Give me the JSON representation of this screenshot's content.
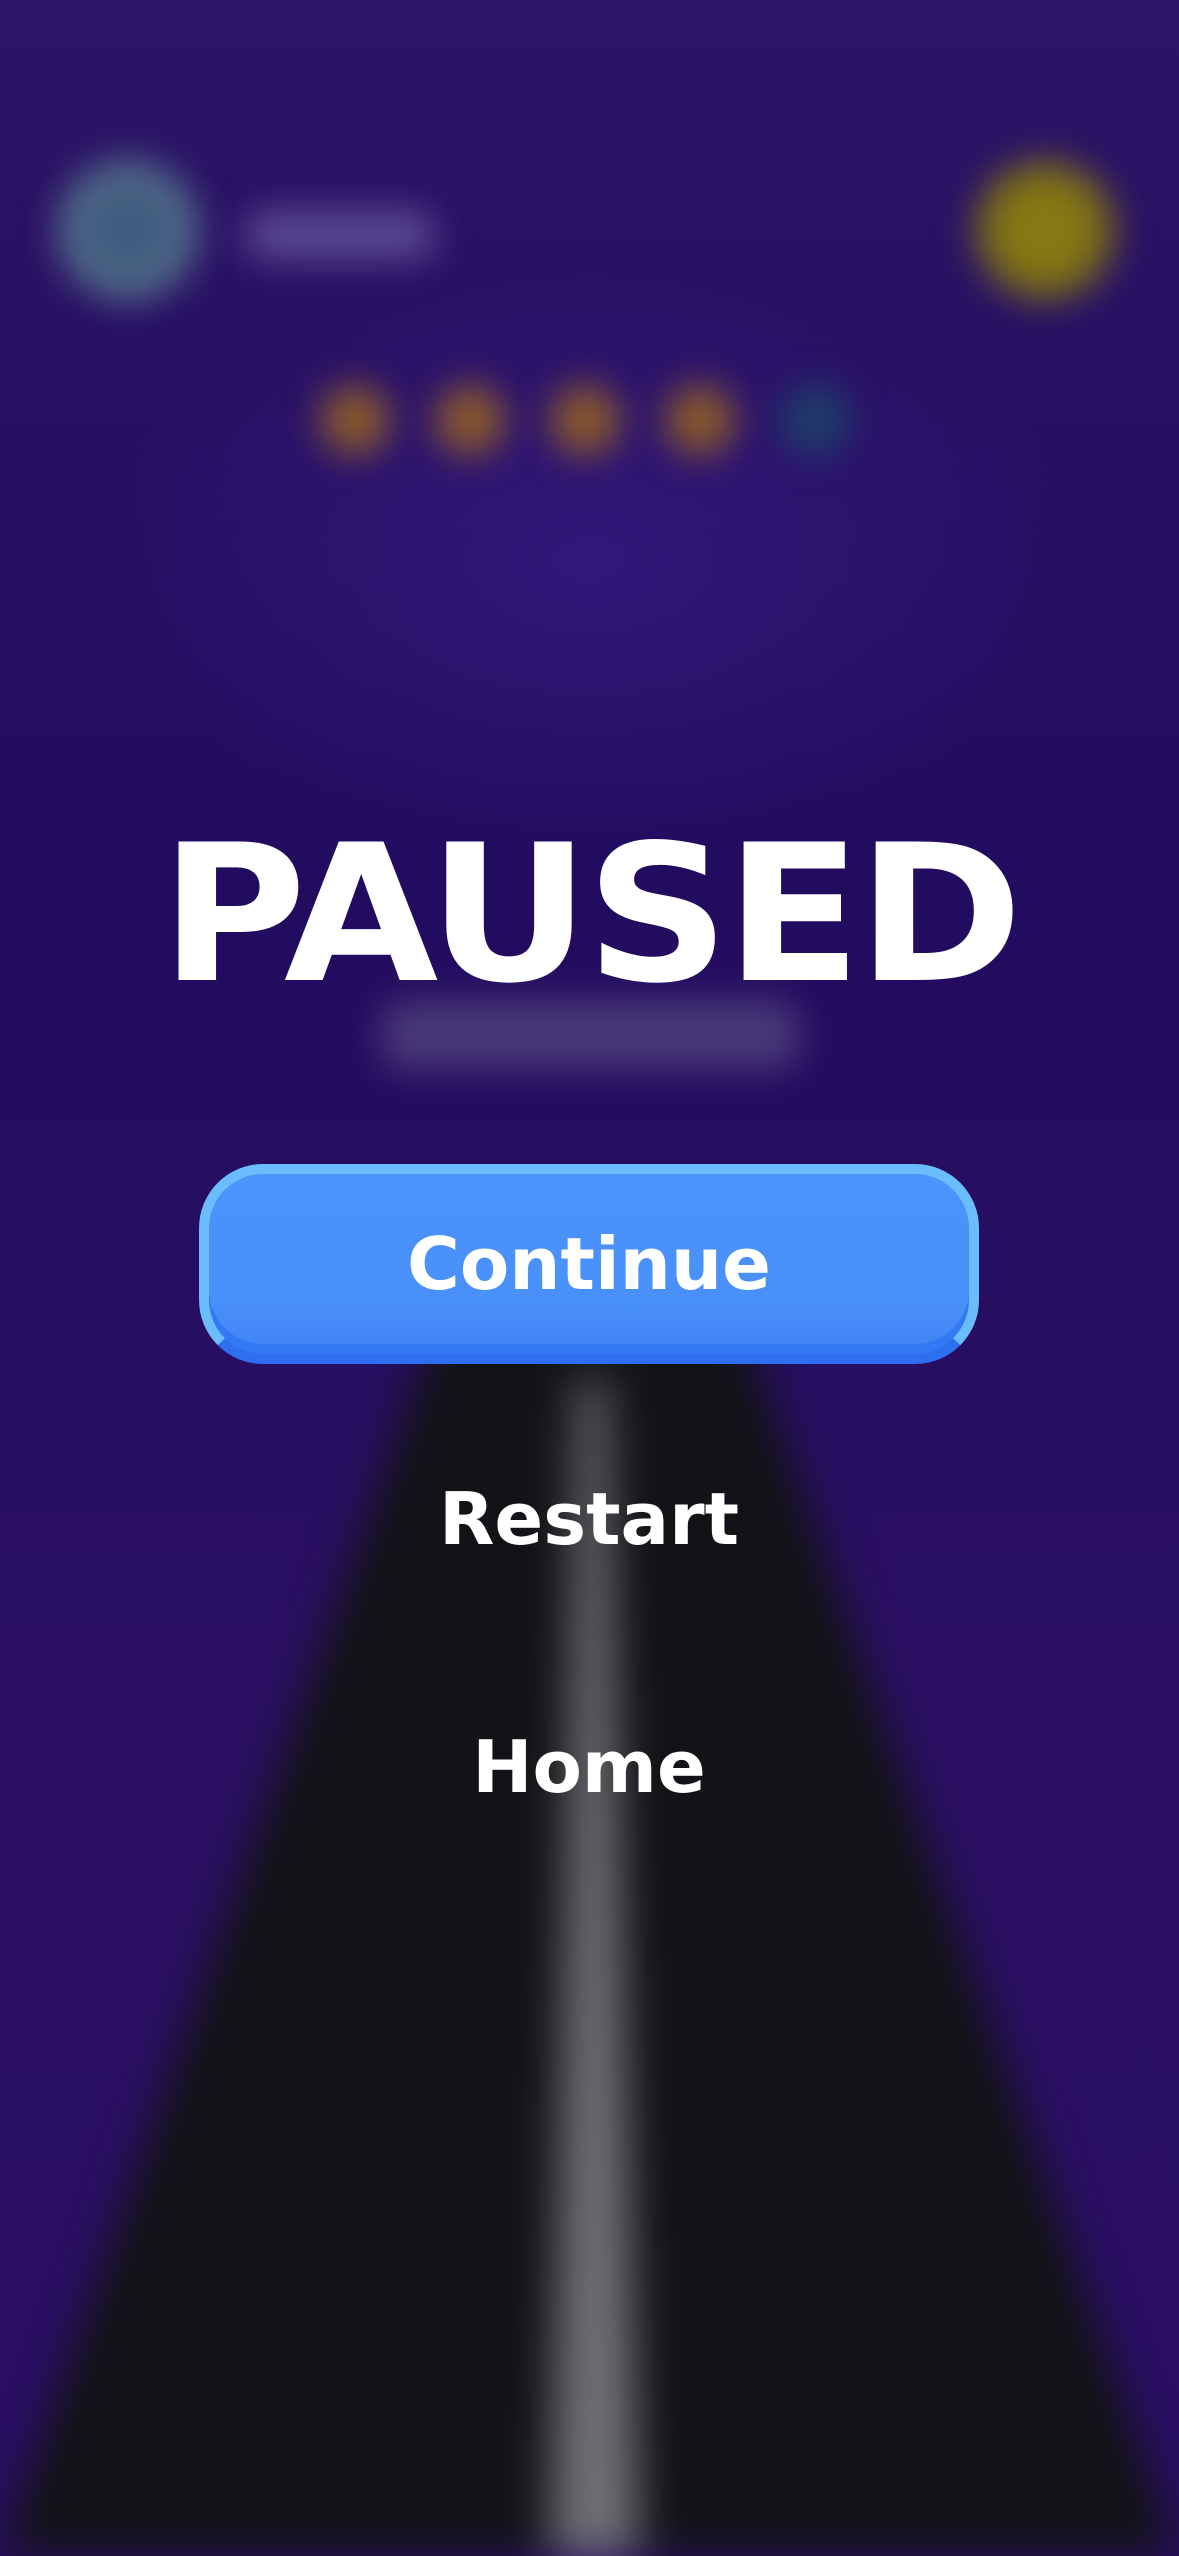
{
  "pause_menu": {
    "title": "PAUSED",
    "continue_label": "Continue",
    "restart_label": "Restart",
    "home_label": "Home"
  },
  "colors": {
    "background": "#22105f",
    "continue_button": "#4a90fa",
    "continue_button_border": "#6bbcfd",
    "road": "#121316",
    "road_line": "#6f6f73",
    "text": "#ffffff"
  },
  "background_hud": {
    "avatar": "avatar-icon",
    "coin": "coin-icon",
    "progress_dots": [
      "orange",
      "orange",
      "orange",
      "orange",
      "blue"
    ]
  }
}
